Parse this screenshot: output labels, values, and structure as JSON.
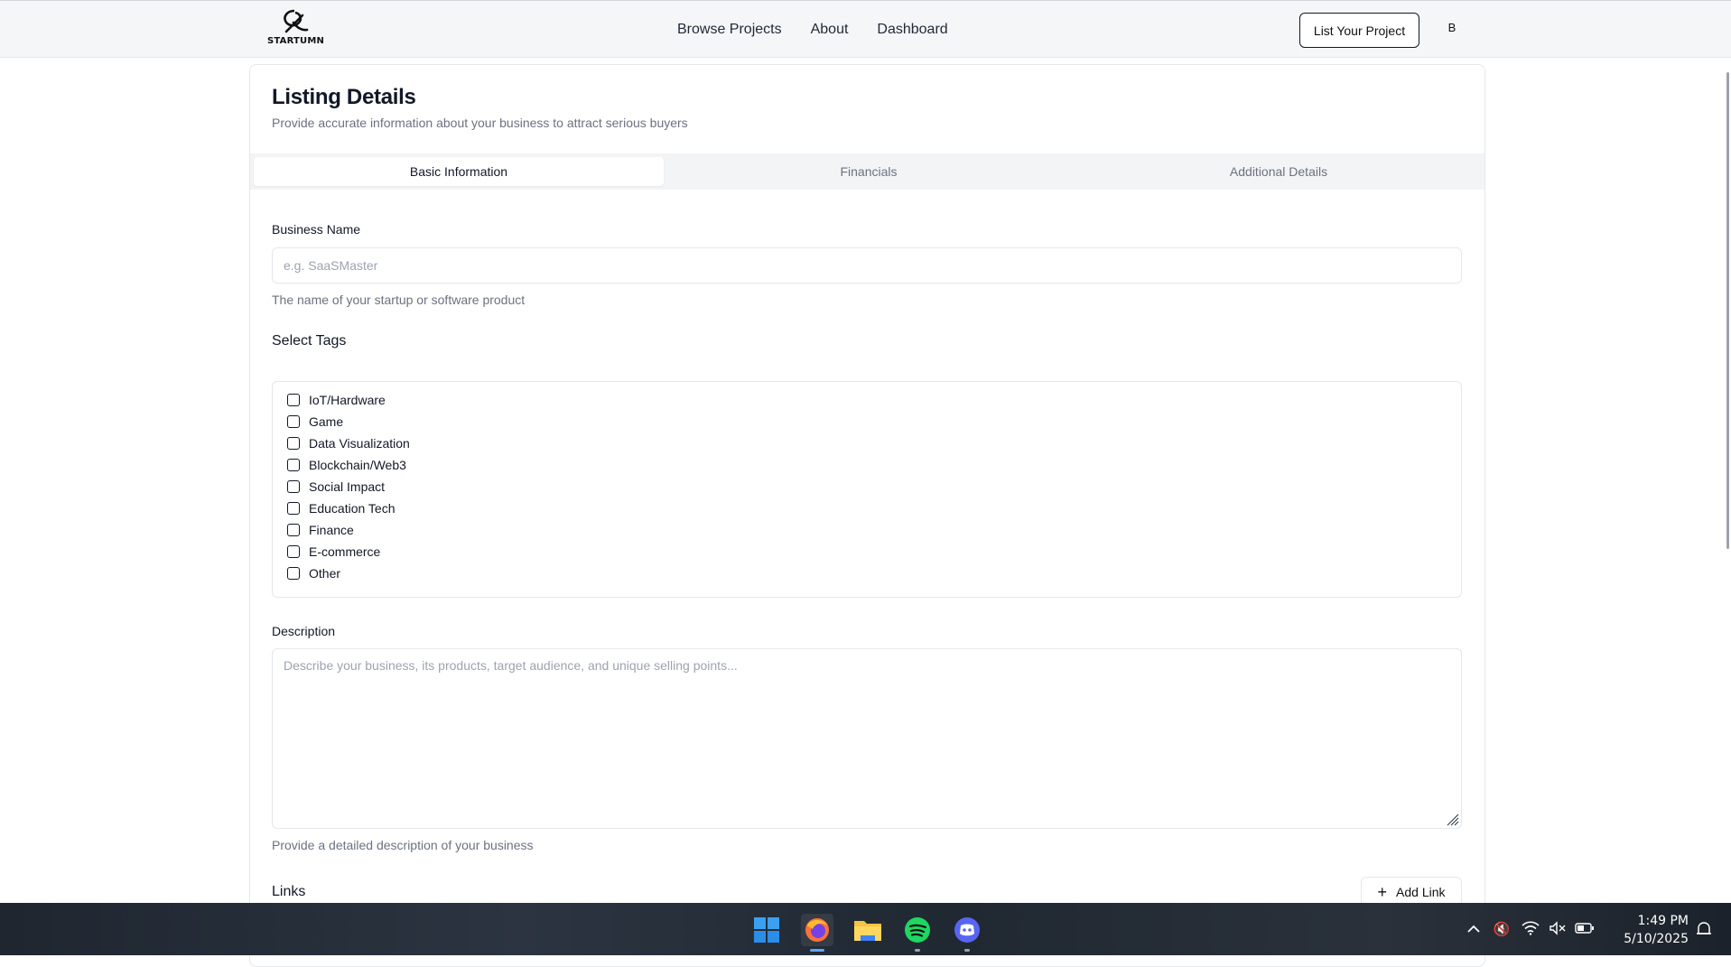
{
  "brand": {
    "name": "STARTUMN"
  },
  "nav": {
    "links": [
      "Browse Projects",
      "About",
      "Dashboard"
    ],
    "cta": "List Your Project",
    "avatar_initial": "B"
  },
  "page": {
    "title": "Listing Details",
    "subtitle": "Provide accurate information about your business to attract serious buyers"
  },
  "tabs": [
    {
      "label": "Basic Information",
      "active": true
    },
    {
      "label": "Financials",
      "active": false
    },
    {
      "label": "Additional Details",
      "active": false
    }
  ],
  "form": {
    "business_name": {
      "label": "Business Name",
      "placeholder": "e.g. SaaSMaster",
      "value": "",
      "help": "The name of your startup or software product"
    },
    "tags": {
      "title": "Select Tags",
      "options": [
        "IoT/Hardware",
        "Game",
        "Data Visualization",
        "Blockchain/Web3",
        "Social Impact",
        "Education Tech",
        "Finance",
        "E-commerce",
        "Other"
      ]
    },
    "description": {
      "label": "Description",
      "placeholder": "Describe your business, its products, target audience, and unique selling points...",
      "help": "Provide a detailed description of your business"
    },
    "links": {
      "title": "Links",
      "add_label": "Add Link"
    }
  },
  "taskbar": {
    "apps": [
      "start-icon",
      "firefox-icon",
      "file-explorer-icon",
      "spotify-icon",
      "discord-icon"
    ],
    "time": "1:49 PM",
    "date": "5/10/2025"
  }
}
